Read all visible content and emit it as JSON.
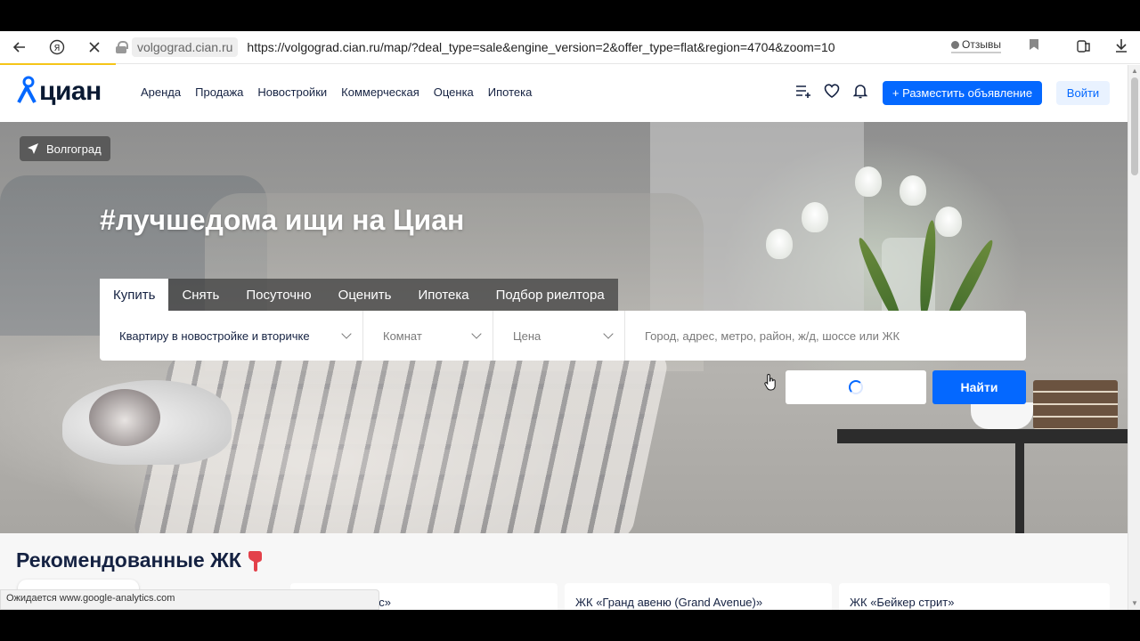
{
  "browser": {
    "domain": "volgograd.cian.ru",
    "url": "https://volgograd.cian.ru/map/?deal_type=sale&engine_version=2&offer_type=flat&region=4704&zoom=10",
    "reviews_label": "Отзывы",
    "status_text": "Ожидается www.google-analytics.com"
  },
  "header": {
    "logo_text": "циан",
    "nav": [
      "Аренда",
      "Продажа",
      "Новостройки",
      "Коммерческая",
      "Оценка",
      "Ипотека"
    ],
    "post_button": "+ Разместить объявление",
    "login_button": "Войти"
  },
  "hero": {
    "city": "Волгоград",
    "headline": "#лучшедома ищи на Циан",
    "tabs": [
      "Купить",
      "Снять",
      "Посуточно",
      "Оценить",
      "Ипотека",
      "Подбор риелтора"
    ],
    "active_tab": "Купить",
    "search": {
      "property_type": "Квартиру в новостройке и вторичке",
      "rooms_placeholder": "Комнат",
      "price_placeholder": "Цена",
      "address_placeholder": "Город, адрес, метро, район, ж/д, шоссе или ЖК"
    },
    "find_button": "Найти"
  },
  "recommended": {
    "title": "Рекомендованные ЖК",
    "cards": [
      "ос»",
      "ЖК «Гранд авеню (Grand Avenue)»",
      "ЖК «Бейкер стрит»"
    ]
  },
  "colors": {
    "accent": "#0468ff",
    "brand_dark": "#152242",
    "loading_bar": "#f5c518"
  }
}
